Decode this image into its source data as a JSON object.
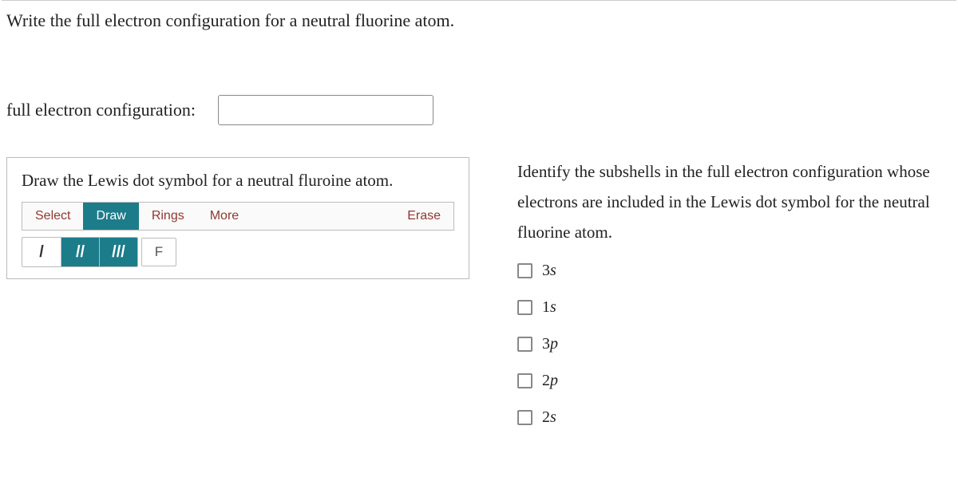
{
  "question": "Write the full electron configuration for a neutral fluorine atom.",
  "input_label": "full electron configuration:",
  "input_value": "",
  "lewis": {
    "prompt": "Draw the Lewis dot symbol for a neutral fluroine atom.",
    "toolbar": {
      "select": "Select",
      "draw": "Draw",
      "rings": "Rings",
      "more": "More",
      "erase": "Erase"
    },
    "tools": {
      "bond1": "/",
      "bond2": "//",
      "bond3": "///",
      "element": "F"
    }
  },
  "subshell_question": "Identify the subshells in the full electron configuration whose electrons are included in the Lewis dot symbol for the neutral fluorine atom.",
  "options": [
    {
      "n": "3",
      "l": "s"
    },
    {
      "n": "1",
      "l": "s"
    },
    {
      "n": "3",
      "l": "p"
    },
    {
      "n": "2",
      "l": "p"
    },
    {
      "n": "2",
      "l": "s"
    }
  ]
}
